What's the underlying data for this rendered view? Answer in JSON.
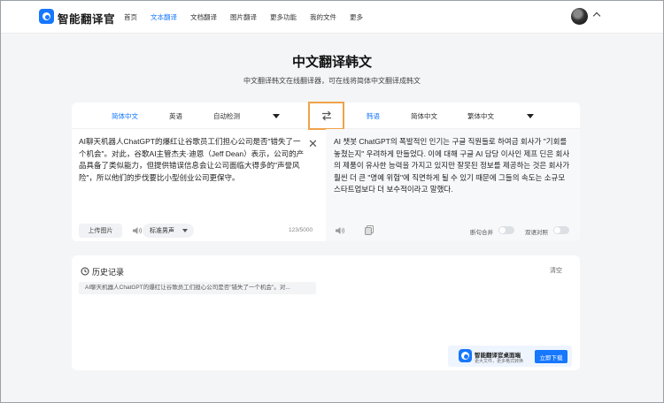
{
  "brand": {
    "name": "智能翻译官"
  },
  "nav": {
    "items": [
      {
        "label": "首页"
      },
      {
        "label": "文本翻译"
      },
      {
        "label": "文档翻译"
      },
      {
        "label": "图片翻译"
      },
      {
        "label": "更多功能"
      },
      {
        "label": "我的文件"
      },
      {
        "label": "更多"
      }
    ],
    "active_index": 1
  },
  "hero": {
    "title": "中文翻译韩文",
    "subtitle": "中文翻译韩文在线翻译器，可在线将简体中文翻译成韩文"
  },
  "translator": {
    "source_langs": [
      "简体中文",
      "英语",
      "自动检测"
    ],
    "target_langs": [
      "韩语",
      "简体中文",
      "繁体中文"
    ],
    "source_text": "AI聊天机器人ChatGPT的爆红让谷歌员工们担心公司是否\"错失了一个机会\"。对此，谷歌AI主管杰夫·迪恩（Jeff Dean）表示，公司的产品具备了类似能力，但提供错误信息会让公司面临大得多的\"声誉风险\"，所以他们的步伐要比小型创业公司更保守。",
    "target_text": "AI 챗봇 ChatGPT의 폭발적인 인기는 구글 직원들로 하여금 회사가 \"기회를 놓쳤는지\" 우려하게 만들었다. 이에 대해 구글 AI 담당 이사인 제프 딘은 회사의 제품이 유사한 능력을 가지고 있지만 잘못된 정보를 제공하는 것은 회사가 훨씬 더 큰 \"명예 위험\"에 직면하게 될 수 있기 때문에 그들의 속도는 소규모 스타트업보다 더 보수적이라고 말했다.",
    "upload_label": "上传图片",
    "voice_label": "标准男声",
    "char_count": "123/5000",
    "sentence_merge_label": "断句合并",
    "bilingual_label": "双语对照"
  },
  "history": {
    "title": "历史记录",
    "clear_label": "清空",
    "items": [
      "AI聊天机器人ChatGPT的爆红让谷歌员工们担心公司是否\"错失了一个机会\"。对..."
    ]
  },
  "promo": {
    "title": "智能翻译官桌面端",
    "subtitle": "更大文件，更多格式转换",
    "button": "立即下载"
  },
  "colors": {
    "accent": "#1677ff",
    "swap_highlight": "#f0a34a",
    "background": "#f4f5f7"
  },
  "icons": [
    "logo-icon",
    "swap-icon",
    "close-icon",
    "speaker-icon",
    "copy-icon",
    "history-icon",
    "avatar",
    "caret-down-icon"
  ]
}
